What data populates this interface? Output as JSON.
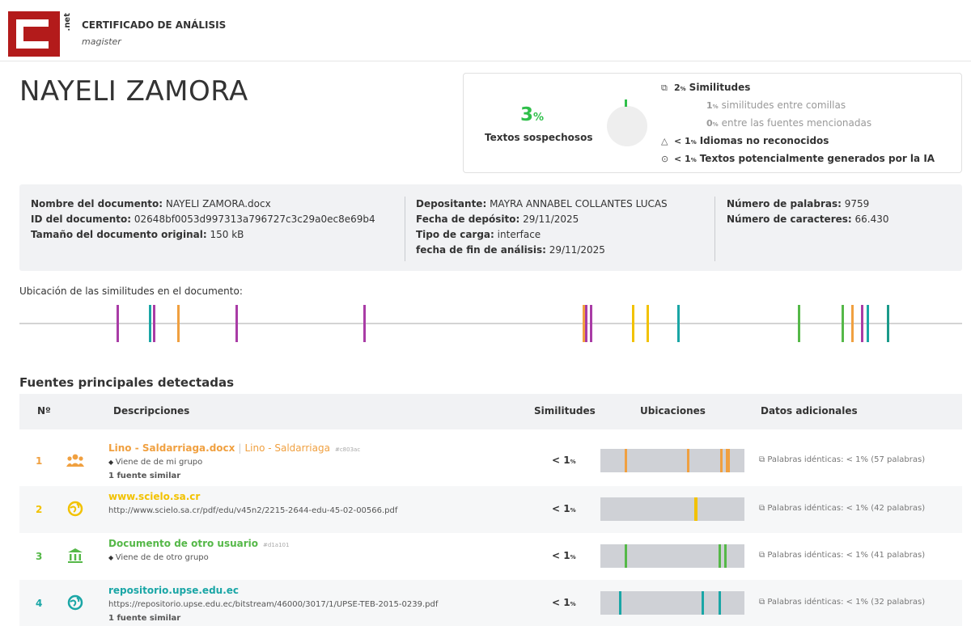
{
  "header": {
    "logo_text": "C",
    "logo_suffix": ".net",
    "title": "CERTIFICADO DE ANÁLISIS",
    "subtitle": "magister"
  },
  "author": "NAYELI ZAMORA",
  "summary": {
    "percent": "3",
    "percent_unit": "%",
    "percent_label": "Textos sospechosos",
    "stats": [
      {
        "icon": "copy-icon",
        "value": "2",
        "unit": "%",
        "label": "Similitudes",
        "muted": false
      },
      {
        "icon": "",
        "value": "1",
        "unit": "%",
        "label": "similitudes entre comillas",
        "muted": true
      },
      {
        "icon": "",
        "value": "0",
        "unit": "%",
        "label": "entre las fuentes mencionadas",
        "muted": true
      },
      {
        "icon": "language-icon",
        "value": "< 1",
        "unit": "%",
        "label": "Idiomas no reconocidos",
        "muted": false
      },
      {
        "icon": "ai-icon",
        "value": "< 1",
        "unit": "%",
        "label": "Textos potencialmente generados por la IA",
        "muted": false
      }
    ]
  },
  "document_info": {
    "col1": [
      {
        "label": "Nombre del documento:",
        "value": "NAYELI ZAMORA.docx"
      },
      {
        "label": "ID del documento:",
        "value": "02648bf0053d997313a796727c3c29a0ec8e69b4"
      },
      {
        "label": "Tamaño del documento original:",
        "value": "150 kB"
      }
    ],
    "col2": [
      {
        "label": "Depositante:",
        "value": "MAYRA ANNABEL COLLANTES LUCAS"
      },
      {
        "label": "Fecha de depósito:",
        "value": "29/11/2025"
      },
      {
        "label": "Tipo de carga:",
        "value": "interface"
      },
      {
        "label": "fecha de fin de análisis:",
        "value": "29/11/2025"
      }
    ],
    "col3": [
      {
        "label": "Número de palabras:",
        "value": "9759"
      },
      {
        "label": "Número de caracteres:",
        "value": "66.430"
      }
    ]
  },
  "location": {
    "label": "Ubicación de las similitudes en el documento:",
    "marks": [
      {
        "pos": 0.103,
        "color": "#a93ca6"
      },
      {
        "pos": 0.137,
        "color": "#1aa6a6"
      },
      {
        "pos": 0.142,
        "color": "#a93ca6"
      },
      {
        "pos": 0.167,
        "color": "#f0a040"
      },
      {
        "pos": 0.229,
        "color": "#a93ca6"
      },
      {
        "pos": 0.365,
        "color": "#a93ca6"
      },
      {
        "pos": 0.597,
        "color": "#f0a040"
      },
      {
        "pos": 0.6,
        "color": "#a93ca6"
      },
      {
        "pos": 0.605,
        "color": "#a93ca6"
      },
      {
        "pos": 0.65,
        "color": "#f2c200"
      },
      {
        "pos": 0.665,
        "color": "#f2c200"
      },
      {
        "pos": 0.698,
        "color": "#1aa6a6"
      },
      {
        "pos": 0.826,
        "color": "#55b848"
      },
      {
        "pos": 0.872,
        "color": "#55b848"
      },
      {
        "pos": 0.882,
        "color": "#f0a040"
      },
      {
        "pos": 0.893,
        "color": "#a93ca6"
      },
      {
        "pos": 0.899,
        "color": "#1aa6a6"
      },
      {
        "pos": 0.92,
        "color": "#1a9a8a"
      }
    ]
  },
  "sources": {
    "title": "Fuentes principales detectadas",
    "headers": {
      "n": "Nº",
      "desc": "Descripciones",
      "sim": "Similitudes",
      "loc": "Ubicaciones",
      "extra": "Datos adicionales"
    },
    "rows": [
      {
        "n": "1",
        "color": "#f0a040",
        "icon": "group-icon",
        "title": "Lino - Saldarriaga.docx",
        "title_alt": "Lino - Saldarriaga",
        "hash": "#c803ac",
        "line2": "Viene de de mi grupo",
        "line2_icon": true,
        "line3": "1 fuente similar",
        "sim": "< 1",
        "sim_unit": "%",
        "marks": [
          0.17,
          0.6,
          0.83,
          0.87,
          0.88
        ],
        "extra": "Palabras idénticas: < 1% (57 palabras)"
      },
      {
        "n": "2",
        "color": "#f2c200",
        "icon": "globe-icon",
        "title": "www.scielo.sa.cr",
        "title_alt": "",
        "hash": "",
        "line2": "http://www.scielo.sa.cr/pdf/edu/v45n2/2215-2644-edu-45-02-00566.pdf",
        "line2_icon": false,
        "line3": "",
        "sim": "< 1",
        "sim_unit": "%",
        "marks": [
          0.65,
          0.66
        ],
        "extra": "Palabras idénticas: < 1% (42 palabras)"
      },
      {
        "n": "3",
        "color": "#55b848",
        "icon": "institution-icon",
        "title": "Documento de otro usuario",
        "title_alt": "",
        "hash": "#d1a101",
        "line2": "Viene de de otro grupo",
        "line2_icon": true,
        "line3": "",
        "sim": "< 1",
        "sim_unit": "%",
        "marks": [
          0.17,
          0.82,
          0.86
        ],
        "extra": "Palabras idénticas: < 1% (41 palabras)"
      },
      {
        "n": "4",
        "color": "#1aa6a6",
        "icon": "globe-icon",
        "title": "repositorio.upse.edu.ec",
        "title_alt": "",
        "hash": "",
        "line2": "https://repositorio.upse.edu.ec/bitstream/46000/3017/1/UPSE-TEB-2015-0239.pdf",
        "line2_icon": false,
        "line3": "1 fuente similar",
        "sim": "< 1",
        "sim_unit": "%",
        "marks": [
          0.13,
          0.7,
          0.82
        ],
        "extra": "Palabras idénticas: < 1% (32 palabras)"
      }
    ]
  }
}
